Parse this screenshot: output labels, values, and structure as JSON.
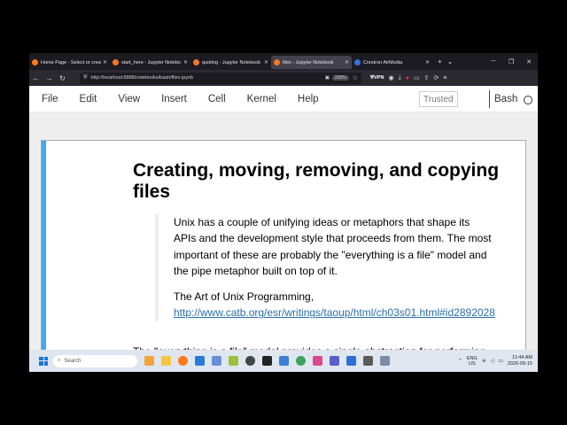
{
  "browser": {
    "tabs": [
      {
        "label": "Home Page - Select or crea",
        "icon": "firefox-icon",
        "active": false
      },
      {
        "label": "start_here - Jupyter Notebo",
        "icon": "jupyter-icon",
        "active": false
      },
      {
        "label": "quoting - Jupyter Notebook",
        "icon": "jupyter-icon",
        "active": false
      },
      {
        "label": "files - Jupyter Notebook",
        "icon": "jupyter-icon",
        "active": true
      },
      {
        "label": "Crestron AirMedia",
        "icon": "crestron-icon",
        "active": false
      }
    ],
    "new_tab_glyph": "+",
    "tab_list_glyph": "⌄",
    "url": "http://localhost:8888/notebooks/bash/files.ipynb",
    "zoom": "200%",
    "vpn_label": "VPN"
  },
  "menubar": {
    "items": [
      "File",
      "Edit",
      "View",
      "Insert",
      "Cell",
      "Kernel",
      "Help"
    ],
    "trusted_label": "Trusted",
    "kernel_name": "Bash"
  },
  "notebook": {
    "heading": "Creating, moving, removing, and copying files",
    "quote_text": "Unix has a couple of unifying ideas or metaphors that shape its APIs and the development style that proceeds from them. The most important of these are probably the \"everything is a file\" model and the pipe metaphor built on top of it.",
    "source_prefix": "The Art of Unix Programming, ",
    "source_link": "http://www.catb.org/esr/writings/taoup/html/ch03s01.html#id2892028",
    "cut_text": "The \"everything is a file\" model provides a single abstraction for performing"
  },
  "taskbar": {
    "search_placeholder": "Search",
    "lang_line1": "ENG",
    "lang_line2": "US",
    "time": "11:44 AM",
    "date": "2026-09-15",
    "accent": "#1f74d8"
  }
}
